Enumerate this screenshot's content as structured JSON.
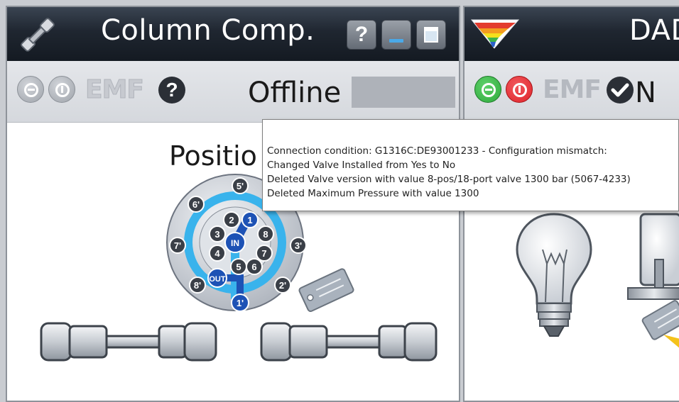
{
  "left_panel": {
    "title": "Column Comp.",
    "icon": "column-icon",
    "window_buttons": {
      "help": "?",
      "minimize": "_",
      "maximize": ""
    },
    "status_icons": [
      "standby-icon",
      "power-icon"
    ],
    "emf_label": "EMF",
    "emf_status_icon": "question-icon",
    "status_text": "Offline",
    "valve_label": "Positio",
    "valve_ports_inner": [
      "1",
      "2",
      "3",
      "4",
      "5",
      "6",
      "7",
      "8"
    ],
    "valve_ports_outer": [
      "1'",
      "2'",
      "3'",
      "5'",
      "6'",
      "7'",
      "8'"
    ],
    "valve_in_label": "IN",
    "valve_out_label": "OUT"
  },
  "right_panel": {
    "title": "DAD",
    "icon": "spectrum-icon",
    "status_icons": [
      "standby-icon",
      "power-icon"
    ],
    "emf_label": "EMF",
    "emf_status_icon": "checkmark-icon",
    "status_text_partial": "N"
  },
  "tooltip": {
    "lines": [
      "Connection condition: G1316C:DE93001233 - Configuration mismatch:",
      "Changed Valve Installed from Yes  to No",
      "Deleted Valve version with value 8-pos/18-port valve 1300 bar (5067-4233)",
      "Deleted Maximum Pressure with value 1300"
    ]
  },
  "colors": {
    "title_bar": "#1f2630",
    "toolbar": "#dcdfe3",
    "standby_green": "#2eaa3c",
    "power_red": "#e0242a",
    "emf_gray": "#b5b9c0",
    "check_dark": "#2b2f36",
    "valve_blue": "#1d52b5",
    "valve_light_blue": "#39b3ec",
    "status_box": "#aeb2b9"
  }
}
